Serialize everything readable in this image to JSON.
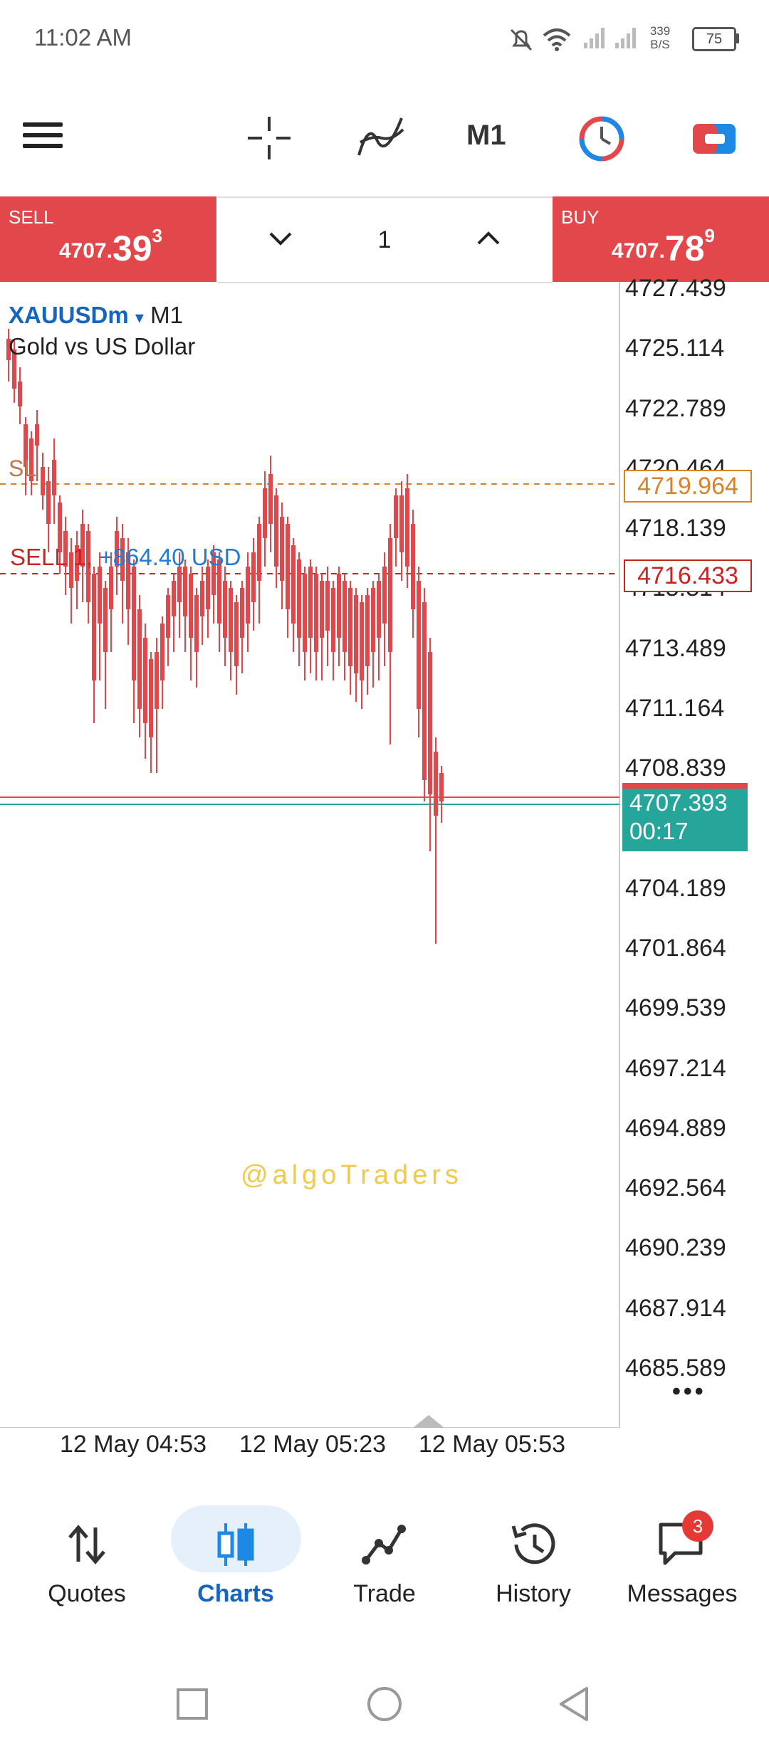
{
  "status_bar": {
    "time": "11:02 AM",
    "net_speed_value": "339",
    "net_speed_unit": "B/S",
    "battery": "75",
    "icons": [
      "mute-bell-icon",
      "wifi-icon",
      "signal-icon",
      "signal-icon",
      "battery-icon"
    ]
  },
  "toolbar": {
    "timeframe": "M1",
    "icons": [
      "menu-icon",
      "crosshair-icon",
      "indicator-icon",
      "timeframe-label",
      "clock-icon",
      "trade-toggle-icon"
    ]
  },
  "trade_panel": {
    "sell_label": "SELL",
    "sell_price_main": "4707.",
    "sell_price_big": "39",
    "sell_price_sup": "3",
    "buy_label": "BUY",
    "buy_price_main": "4707.",
    "buy_price_big": "78",
    "buy_price_sup": "9",
    "lot": "1"
  },
  "chart": {
    "symbol": "XAUUSDm",
    "symbol_arrow": "▾",
    "timeframe": "M1",
    "description": "Gold vs US Dollar",
    "sl_label": "SL",
    "position_label": "SELL 1, ",
    "position_profit": "+864.40 USD",
    "watermark": "@algoTraders",
    "sl_price": "4719.964",
    "entry_price": "4716.433",
    "bid_price": "4707.393",
    "countdown": "00:17",
    "price_ticks": [
      "4727.439",
      "4725.114",
      "4722.789",
      "4720.464",
      "4718.139",
      "4715.814",
      "4713.489",
      "4711.164",
      "4708.839",
      "4704.189",
      "4701.864",
      "4699.539",
      "4697.214",
      "4694.889",
      "4692.564",
      "4690.239",
      "4687.914",
      "4685.589"
    ],
    "time_ticks": [
      "12 May 04:53",
      "12 May 05:23",
      "12 May 05:53"
    ],
    "colors": {
      "bull": "#26a69a",
      "bear": "#e2484b",
      "sl": "#d9822b",
      "entry": "#cc2222"
    }
  },
  "bottom_nav": {
    "items": [
      {
        "label": "Quotes",
        "icon": "arrows-updown-icon"
      },
      {
        "label": "Charts",
        "icon": "candles-icon"
      },
      {
        "label": "Trade",
        "icon": "trade-line-icon"
      },
      {
        "label": "History",
        "icon": "history-icon"
      },
      {
        "label": "Messages",
        "icon": "chat-icon"
      }
    ],
    "messages_badge": "3"
  }
}
